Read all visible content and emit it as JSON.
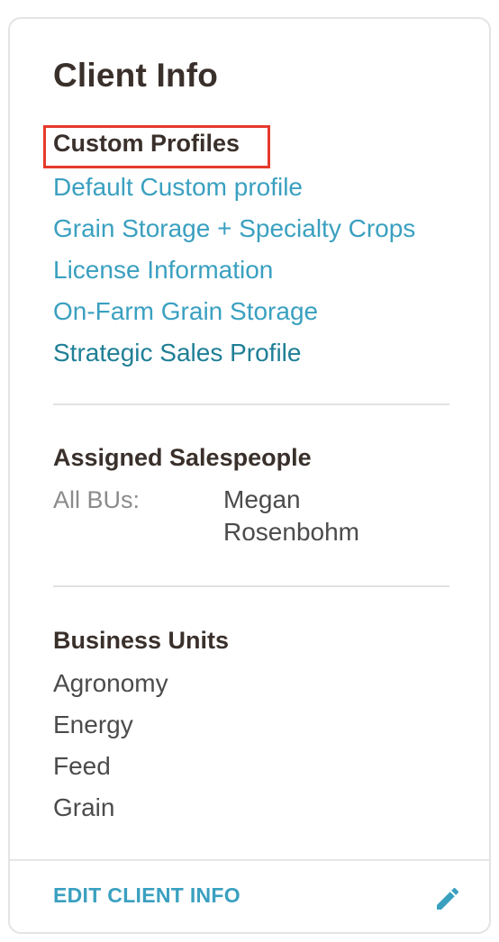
{
  "card": {
    "title": "Client Info"
  },
  "custom_profiles": {
    "heading": "Custom Profiles",
    "items": [
      "Default Custom profile",
      "Grain Storage + Specialty Crops",
      "License Information",
      "On-Farm Grain Storage",
      "Strategic Sales Profile"
    ]
  },
  "assigned_salespeople": {
    "heading": "Assigned Salespeople",
    "label": "All BUs:",
    "value": "Megan Rosenbohm"
  },
  "business_units": {
    "heading": "Business Units",
    "items": [
      "Agronomy",
      "Energy",
      "Feed",
      "Grain"
    ]
  },
  "footer": {
    "edit_label": "EDIT CLIENT INFO",
    "edit_icon": "pencil-icon"
  },
  "colors": {
    "link": "#3aa0c0",
    "visited_link": "#1f7f96",
    "highlight_border": "#e6392b",
    "heading": "#3a302b"
  }
}
